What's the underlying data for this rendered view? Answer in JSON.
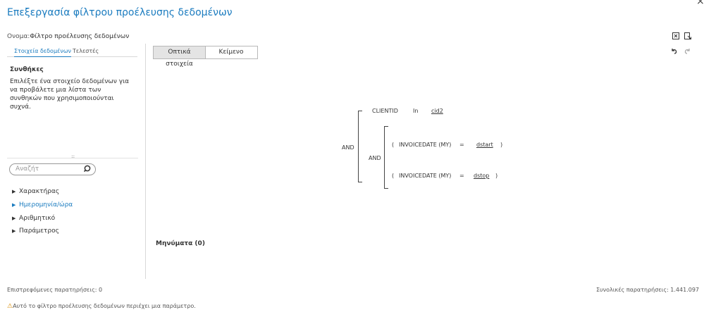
{
  "window": {
    "title": "Επεξεργασία φίλτρου προέλευσης δεδομένων",
    "close_glyph": "×"
  },
  "name_field": {
    "label": "Ονομα:",
    "value": "Φίλτρο προέλευσης δεδομένων"
  },
  "toolbar_icons": [
    "close-all-icon",
    "export-icon",
    "undo-icon",
    "redo-icon"
  ],
  "left_panel": {
    "tabs": [
      {
        "label": "Στοιχεία δεδομένων",
        "active": true
      },
      {
        "label": "Τελεστές",
        "active": false
      }
    ],
    "conditions_title": "Συνθήκες",
    "conditions_text": "Επιλέξτε ένα στοιχείο δεδομένων για να προβάλετε μια λίστα των συνθηκών που χρησιμοποιούνται συχνά.",
    "search": {
      "placeholder": "Αναζήτ"
    },
    "tree": [
      {
        "label": "Χαρακτήρας",
        "highlighted": false
      },
      {
        "label": "Ημερομηνία/ώρα",
        "highlighted": true
      },
      {
        "label": "Αριθμητικό",
        "highlighted": false
      },
      {
        "label": "Παράμετρος",
        "highlighted": false
      }
    ]
  },
  "view_toggle": {
    "visual": "Οπτικά στοιχεία",
    "text": "Κείμενο",
    "selected": "visual"
  },
  "expression": {
    "outer_op": "AND",
    "inner_op": "AND",
    "cond1": {
      "field": "CLIENTID",
      "op": "In",
      "value": "cid2"
    },
    "cond2": {
      "open": "(",
      "field": "INVOICEDATE (MY)",
      "op": "=",
      "value": "dstart",
      "close": ")"
    },
    "cond3": {
      "open": "(",
      "field": "INVOICEDATE (MY)",
      "op": "=",
      "value": "dstop",
      "close": ")"
    }
  },
  "messages_label": "Μηνύματα (0)",
  "footer": {
    "returned": "Επιστρεφόμενες παρατηρήσεις: 0",
    "total": "Συνολικές παρατηρήσεις: 1.441.097",
    "warning": "Αυτό το φίλτρο προέλευσης δεδομένων περιέχει μια παράμετρο.",
    "warning_icon": "warning-icon"
  },
  "colors": {
    "accent": "#1a7bbf",
    "warning": "#d98a00"
  }
}
